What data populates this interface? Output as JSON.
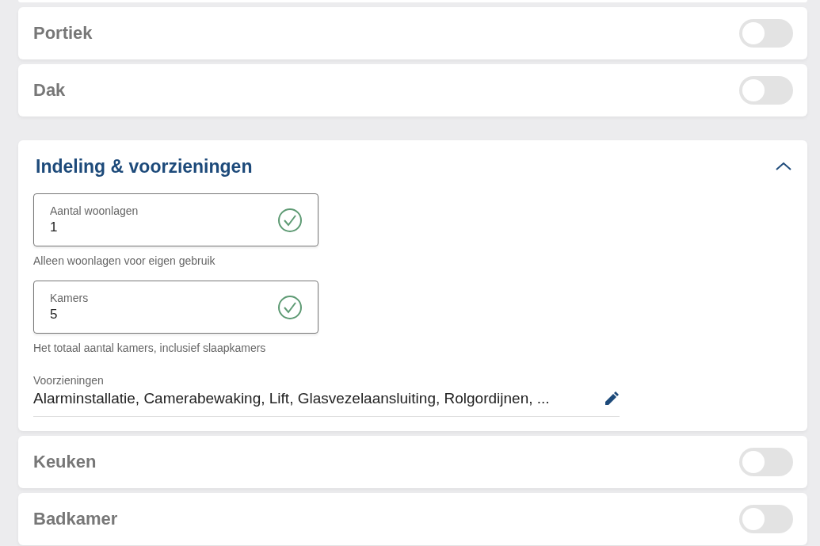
{
  "sections": [
    {
      "kind": "toggle",
      "title": "Portiek",
      "on": false
    },
    {
      "kind": "toggle",
      "title": "Dak",
      "on": false
    },
    {
      "kind": "panel",
      "title": "Indeling & voorzieningen",
      "expanded": true,
      "fields": [
        {
          "label": "Aantal woonlagen",
          "value": "1",
          "valid": true,
          "hint": "Alleen woonlagen voor eigen gebruik"
        },
        {
          "label": "Kamers",
          "value": "5",
          "valid": true,
          "hint": "Het totaal aantal kamers, inclusief slaapkamers"
        }
      ],
      "selection": {
        "label": "Voorzieningen",
        "value": "Alarminstallatie, Camerabewaking, Lift, Glasvezelaansluiting, Rolgordijnen, ..."
      }
    },
    {
      "kind": "toggle",
      "title": "Keuken",
      "on": false
    },
    {
      "kind": "toggle",
      "title": "Badkamer",
      "on": false
    }
  ]
}
